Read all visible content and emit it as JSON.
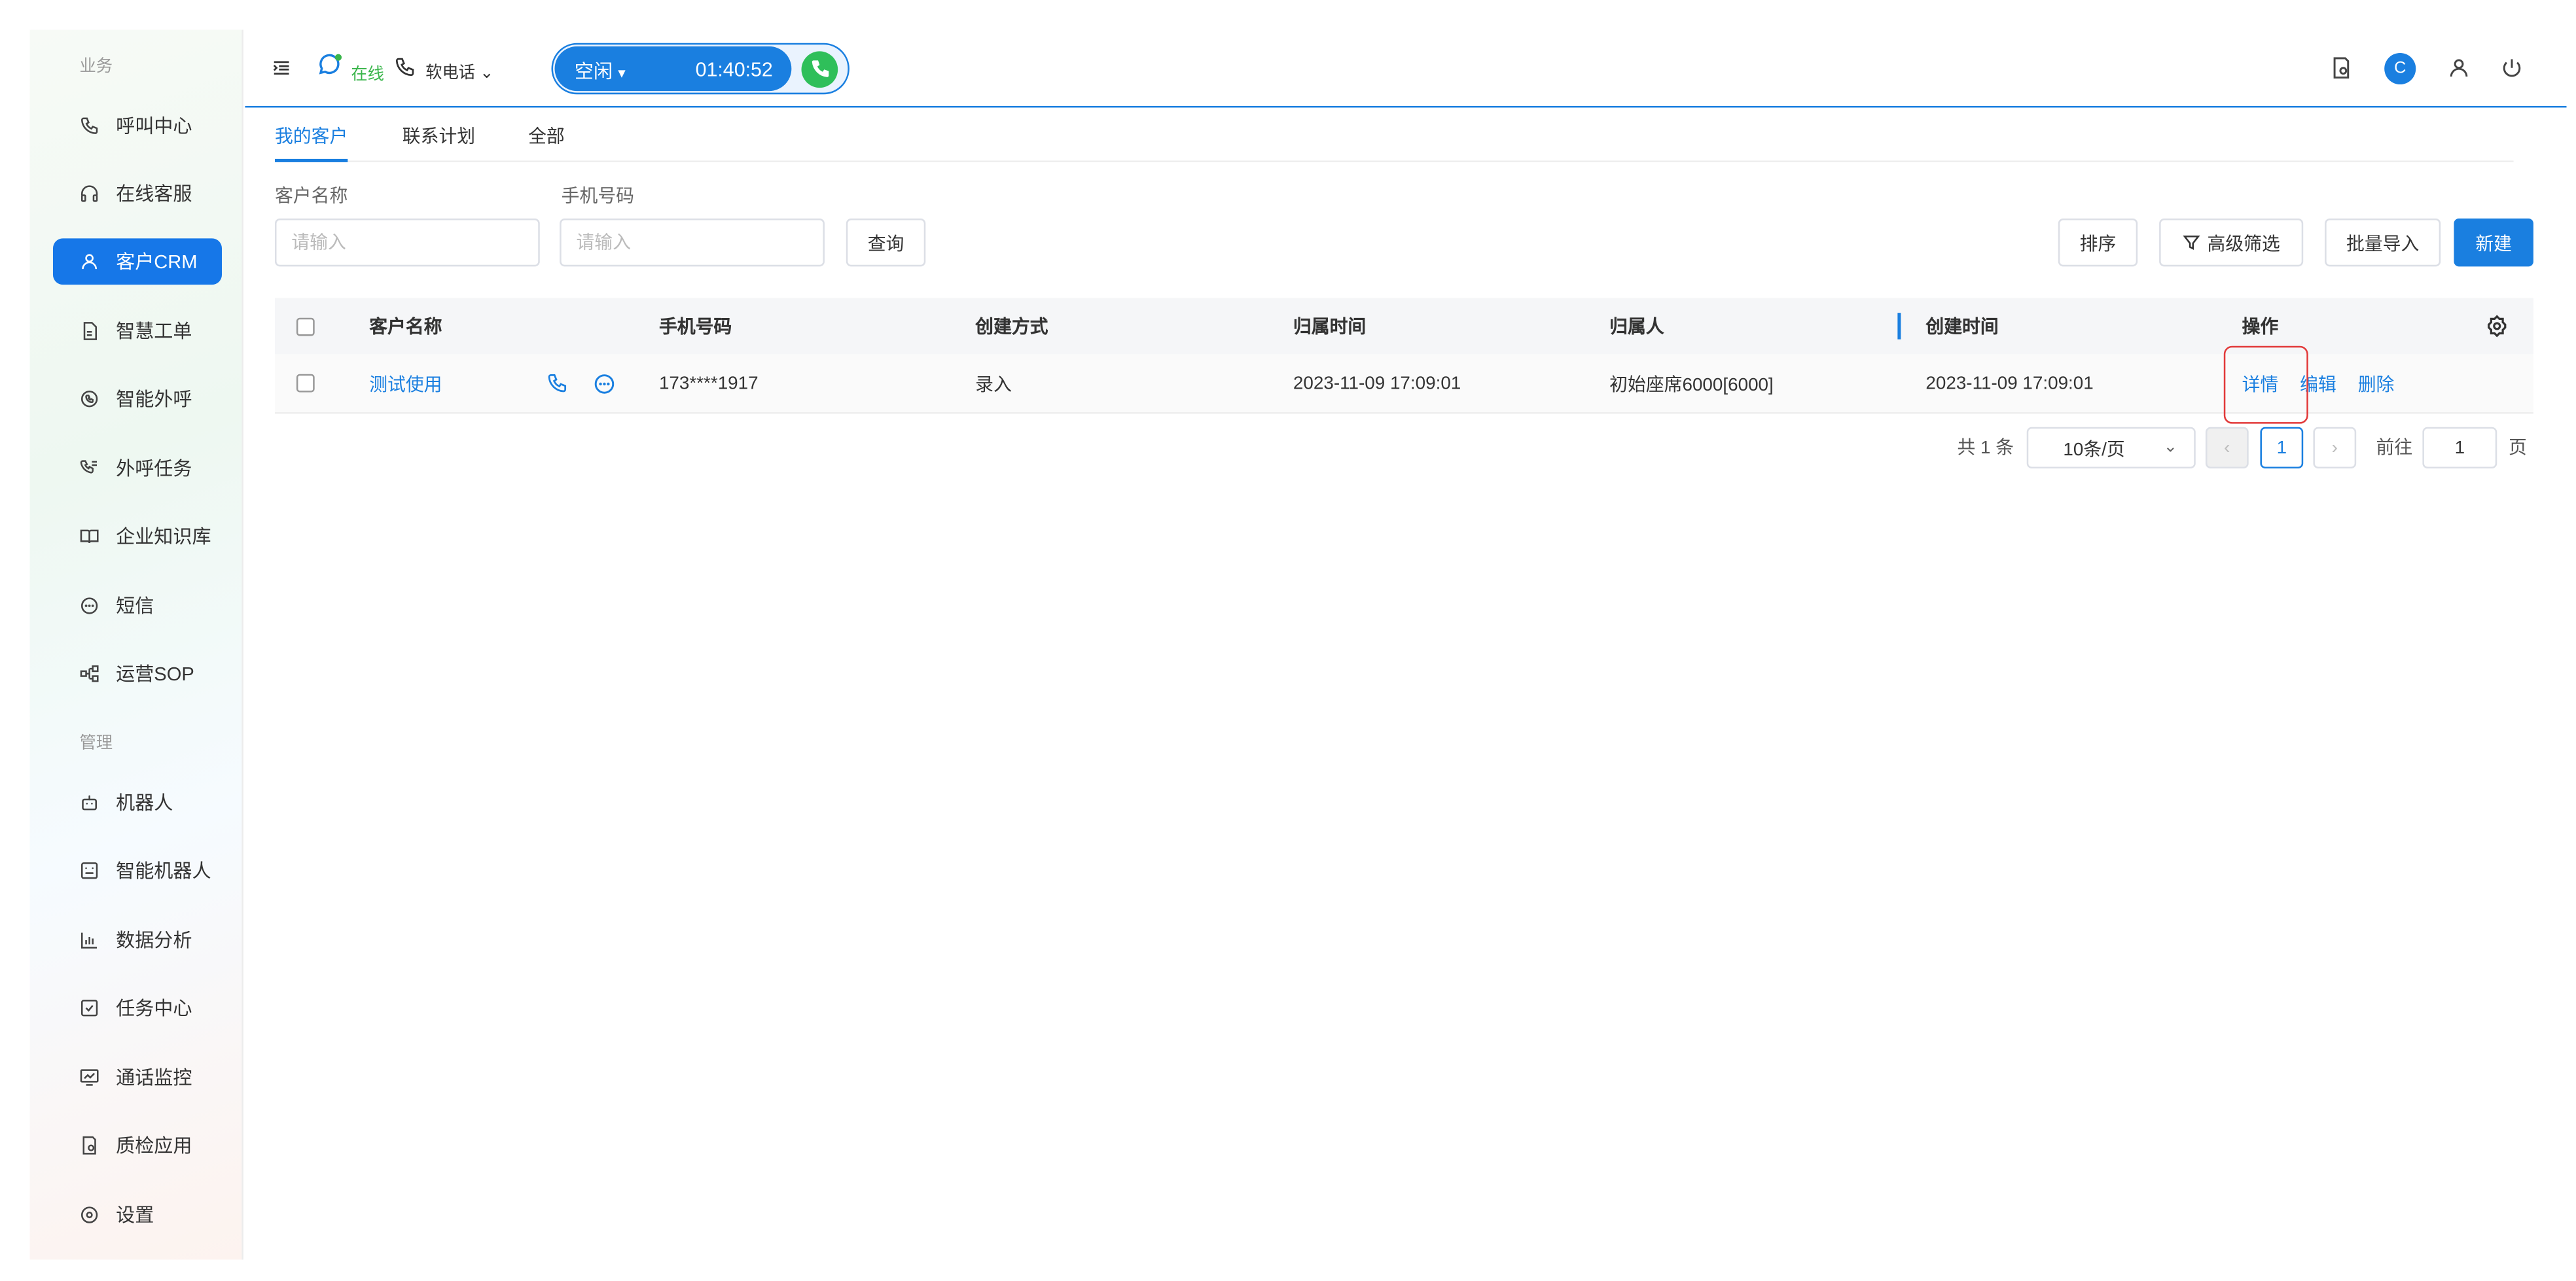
{
  "sidebar": {
    "section_business": "业务",
    "section_management": "管理",
    "items": [
      {
        "label": "呼叫中心",
        "icon": "phone-icon"
      },
      {
        "label": "在线客服",
        "icon": "headset-icon"
      },
      {
        "label": "客户CRM",
        "icon": "user-icon"
      },
      {
        "label": "智慧工单",
        "icon": "document-icon"
      },
      {
        "label": "智能外呼",
        "icon": "whatsapp-phone-icon"
      },
      {
        "label": "外呼任务",
        "icon": "phone-list-icon"
      },
      {
        "label": "企业知识库",
        "icon": "book-icon"
      },
      {
        "label": "短信",
        "icon": "sms-icon"
      },
      {
        "label": "运营SOP",
        "icon": "flow-icon"
      },
      {
        "label": "机器人",
        "icon": "robot-icon"
      },
      {
        "label": "智能机器人",
        "icon": "smart-robot-icon"
      },
      {
        "label": "数据分析",
        "icon": "bar-chart-icon"
      },
      {
        "label": "任务中心",
        "icon": "task-check-icon"
      },
      {
        "label": "通话监控",
        "icon": "monitor-chart-icon"
      },
      {
        "label": "质检应用",
        "icon": "quality-check-icon"
      },
      {
        "label": "设置",
        "icon": "settings-icon"
      }
    ],
    "active_item": "客户CRM"
  },
  "topbar": {
    "status_online": "在线",
    "softphone_label": "软电话",
    "call_status": "空闲",
    "call_timer": "01:40:52",
    "avatar_letter": "C"
  },
  "tabs": [
    "我的客户",
    "联系计划",
    "全部"
  ],
  "filters": {
    "customer_name_label": "客户名称",
    "customer_name_placeholder": "请输入",
    "phone_label": "手机号码",
    "phone_placeholder": "请输入",
    "query_button": "查询"
  },
  "actions": {
    "sort": "排序",
    "advanced_filter": "高级筛选",
    "batch_import": "批量导入",
    "new": "新建"
  },
  "table": {
    "headers": [
      "客户名称",
      "手机号码",
      "创建方式",
      "归属时间",
      "归属人",
      "创建时间",
      "操作"
    ],
    "rows": [
      {
        "name": "测试使用",
        "phone": "173****1917",
        "create_method": "录入",
        "assign_time": "2023-11-09 17:09:01",
        "owner": "初始座席6000[6000]",
        "create_time": "2023-11-09 17:09:01",
        "ops": [
          "详情",
          "编辑",
          "删除"
        ]
      }
    ]
  },
  "pagination": {
    "total": "共 1 条",
    "page_size": "10条/页",
    "current_page": "1",
    "goto_label": "前往",
    "goto_value": "1",
    "page_suffix": "页"
  },
  "colors": {
    "primary": "#1a7fe0",
    "online_green": "#39b54a",
    "answer_green": "#2fbf5a",
    "highlight_red": "#e23a3a"
  }
}
